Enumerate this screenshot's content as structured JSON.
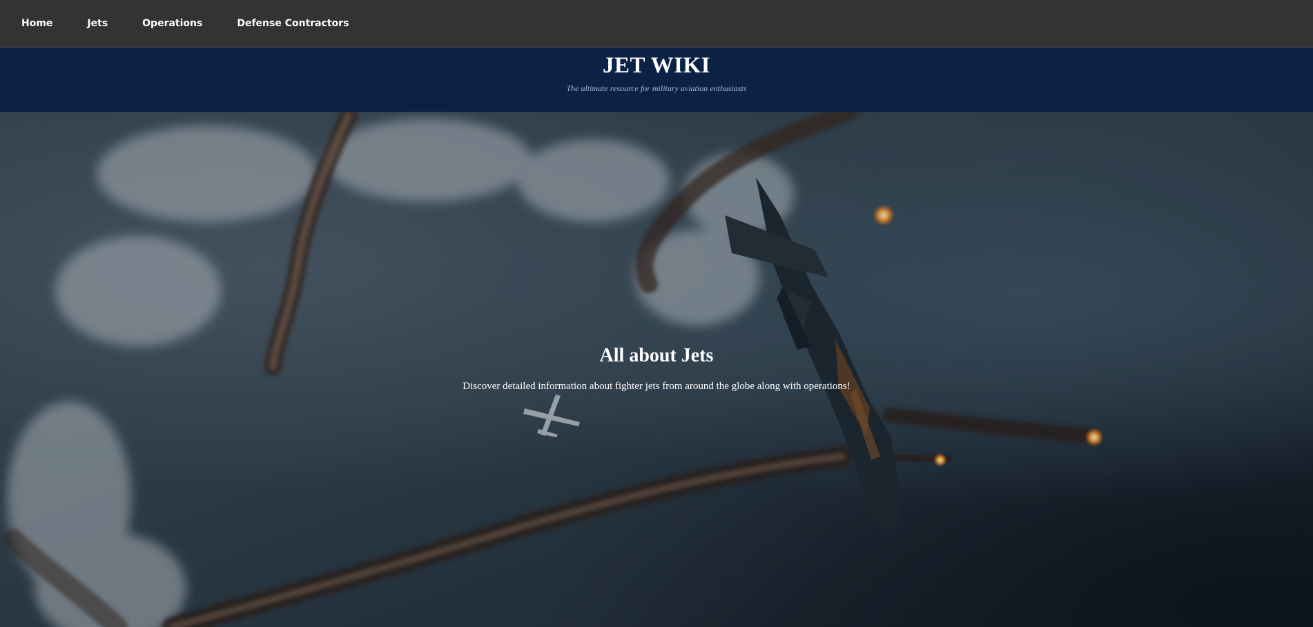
{
  "nav": {
    "items": [
      {
        "label": "Home"
      },
      {
        "label": "Jets"
      },
      {
        "label": "Operations"
      },
      {
        "label": "Defense Contractors"
      }
    ]
  },
  "header": {
    "title": "JET WIKI",
    "tagline": "The ultimate resource for military aviation enthusiasts"
  },
  "hero": {
    "heading": "All about Jets",
    "text": "Discover detailed information about fighter jets from around the globe along with operations!",
    "image_icon": "fighter-jet-flares-photo"
  },
  "colors": {
    "nav_bg": "#333333",
    "banner_bg": "#0b2245",
    "tagline": "#a9bdd6",
    "text": "#ffffff"
  }
}
